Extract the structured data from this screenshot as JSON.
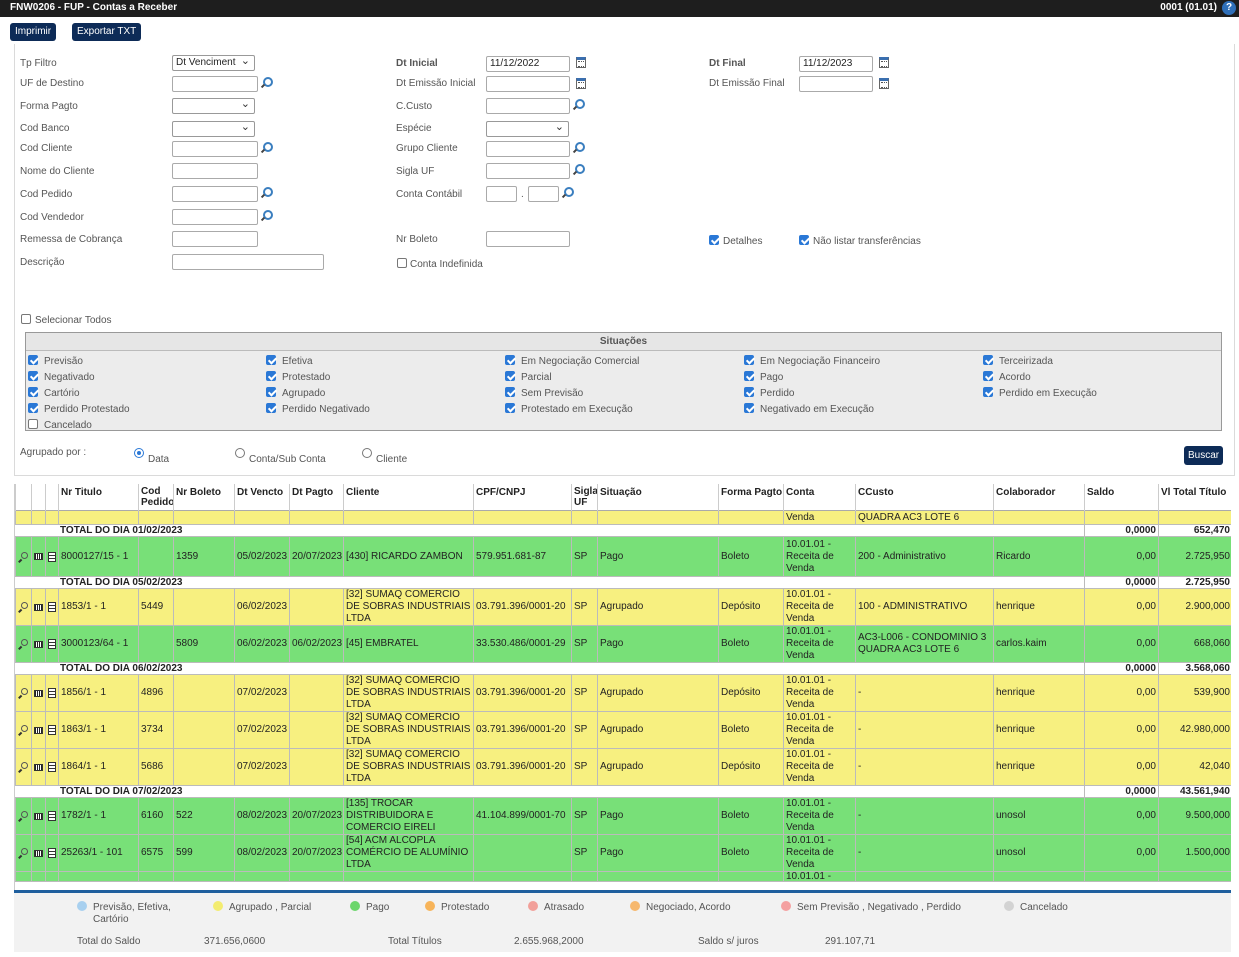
{
  "window": {
    "title": "FNW0206 - FUP - Contas a Receber",
    "right": "0001 (01.01)",
    "help": "?"
  },
  "toolbar": {
    "print": "Imprimir",
    "export": "Exportar TXT"
  },
  "filters": {
    "tp_filtro": {
      "label": "Tp Filtro",
      "value": "Dt Venciment"
    },
    "uf_destino": {
      "label": "UF de Destino"
    },
    "forma_pagto": {
      "label": "Forma Pagto"
    },
    "cod_banco": {
      "label": "Cod Banco"
    },
    "cod_cliente": {
      "label": "Cod Cliente"
    },
    "nome_cliente": {
      "label": "Nome do Cliente"
    },
    "cod_pedido": {
      "label": "Cod Pedido"
    },
    "cod_vendedor": {
      "label": "Cod Vendedor"
    },
    "remessa": {
      "label": "Remessa de Cobrança"
    },
    "descricao": {
      "label": "Descrição"
    },
    "dt_inicial": {
      "label": "Dt Inicial",
      "value": "11/12/2022"
    },
    "dt_emissao_inicial": {
      "label": "Dt Emissão Inicial"
    },
    "ccusto": {
      "label": "C.Custo"
    },
    "especie": {
      "label": "Espécie"
    },
    "grupo_cliente": {
      "label": "Grupo Cliente"
    },
    "sigla_uf": {
      "label": "Sigla UF"
    },
    "conta_contabil": {
      "label": "Conta Contábil",
      "sep": "."
    },
    "nr_boleto": {
      "label": "Nr Boleto"
    },
    "conta_indefinida": {
      "label": "Conta Indefinida"
    },
    "dt_final": {
      "label": "Dt Final",
      "value": "11/12/2023"
    },
    "dt_emissao_final": {
      "label": "Dt Emissão Final"
    },
    "detalhes": {
      "label": "Detalhes"
    },
    "nao_listar": {
      "label": "Não listar transferências"
    },
    "selecionar_todos": {
      "label": "Selecionar Todos"
    }
  },
  "situacoes": {
    "title": "Situações",
    "items": [
      [
        "Previsão",
        "Efetiva",
        "Em Negociação Comercial",
        "Em Negociação Financeiro",
        "Terceirizada"
      ],
      [
        "Negativado",
        "Protestado",
        "Parcial",
        "Pago",
        "Acordo"
      ],
      [
        "Cartório",
        "Agrupado",
        "Sem Previsão",
        "Perdido",
        "Perdido em Execução"
      ],
      [
        "Perdido Protestado",
        "Perdido Negativado",
        "Protestado em Execução",
        "Negativado em Execução",
        ""
      ],
      [
        "Cancelado",
        "",
        "",
        "",
        ""
      ]
    ]
  },
  "agrupado": {
    "label": "Agrupado por :",
    "options": [
      "Data",
      "Conta/Sub Conta",
      "Cliente"
    ],
    "selected": "Data"
  },
  "buscar": "Buscar",
  "columns": [
    "Nr Titulo",
    "Cod Pedido",
    "Nr Boleto",
    "Dt Vencto",
    "Dt Pagto",
    "Cliente",
    "CPF/CNPJ",
    "Sigla UF",
    "Situação",
    "Forma Pagto",
    "Conta",
    "CCusto",
    "Colaborador",
    "Saldo",
    "Vl Total Título"
  ],
  "rows": [
    {
      "type": "partial",
      "conta": "Venda",
      "ccusto": "QUADRA AC3 LOTE 6"
    },
    {
      "type": "total",
      "label": "TOTAL DO DIA 01/02/2023",
      "saldo": "0,0000",
      "total": "652,470"
    },
    {
      "type": "green",
      "nr": "8000127/15 - 1",
      "ped": "",
      "bol": "1359",
      "venc": "05/02/2023",
      "pag": "20/07/2023",
      "cli": "[430] RICARDO ZAMBON",
      "cpf": "579.951.681-87",
      "uf": "SP",
      "sit": "Pago",
      "forma": "Boleto",
      "conta": "10.01.01 - Receita de Venda",
      "cc": "200 - Administrativo",
      "col": "Ricardo",
      "saldo": "0,00",
      "total": "2.725,950"
    },
    {
      "type": "total",
      "label": "TOTAL DO DIA 05/02/2023",
      "saldo": "0,0000",
      "total": "2.725,950"
    },
    {
      "type": "yellow",
      "nr": "1853/1 - 1",
      "ped": "5449",
      "bol": "",
      "venc": "06/02/2023",
      "pag": "",
      "cli": "[32] SUMAQ COMERCIO DE SOBRAS INDUSTRIAIS LTDA",
      "cpf": "03.791.396/0001-20",
      "uf": "SP",
      "sit": "Agrupado",
      "forma": "Depósito",
      "conta": "10.01.01 - Receita de Venda",
      "cc": "100 - ADMINISTRATIVO",
      "col": "henrique",
      "saldo": "0,00",
      "total": "2.900,000"
    },
    {
      "type": "green",
      "nr": "3000123/64 - 1",
      "ped": "",
      "bol": "5809",
      "venc": "06/02/2023",
      "pag": "06/02/2023",
      "cli": "[45] EMBRATEL",
      "cpf": "33.530.486/0001-29",
      "uf": "SP",
      "sit": "Pago",
      "forma": "Boleto",
      "conta": "10.01.01 - Receita de Venda",
      "cc": "AC3-L006 - CONDOMINIO 3 QUADRA AC3 LOTE 6",
      "col": "carlos.kaim",
      "saldo": "0,00",
      "total": "668,060"
    },
    {
      "type": "total",
      "label": "TOTAL DO DIA 06/02/2023",
      "saldo": "0,0000",
      "total": "3.568,060"
    },
    {
      "type": "yellow",
      "nr": "1856/1 - 1",
      "ped": "4896",
      "bol": "",
      "venc": "07/02/2023",
      "pag": "",
      "cli": "[32] SUMAQ COMERCIO DE SOBRAS INDUSTRIAIS LTDA",
      "cpf": "03.791.396/0001-20",
      "uf": "SP",
      "sit": "Agrupado",
      "forma": "Depósito",
      "conta": "10.01.01 - Receita de Venda",
      "cc": "-",
      "col": "henrique",
      "saldo": "0,00",
      "total": "539,900"
    },
    {
      "type": "yellow",
      "nr": "1863/1 - 1",
      "ped": "3734",
      "bol": "",
      "venc": "07/02/2023",
      "pag": "",
      "cli": "[32] SUMAQ COMERCIO DE SOBRAS INDUSTRIAIS LTDA",
      "cpf": "03.791.396/0001-20",
      "uf": "SP",
      "sit": "Agrupado",
      "forma": "Boleto",
      "conta": "10.01.01 - Receita de Venda",
      "cc": "-",
      "col": "henrique",
      "saldo": "0,00",
      "total": "42.980,000"
    },
    {
      "type": "yellow",
      "nr": "1864/1 - 1",
      "ped": "5686",
      "bol": "",
      "venc": "07/02/2023",
      "pag": "",
      "cli": "[32] SUMAQ COMERCIO DE SOBRAS INDUSTRIAIS LTDA",
      "cpf": "03.791.396/0001-20",
      "uf": "SP",
      "sit": "Agrupado",
      "forma": "Depósito",
      "conta": "10.01.01 - Receita de Venda",
      "cc": "-",
      "col": "henrique",
      "saldo": "0,00",
      "total": "42,040"
    },
    {
      "type": "total",
      "label": "TOTAL DO DIA 07/02/2023",
      "saldo": "0,0000",
      "total": "43.561,940"
    },
    {
      "type": "green",
      "nr": "1782/1 - 1",
      "ped": "6160",
      "bol": "522",
      "venc": "08/02/2023",
      "pag": "20/07/2023",
      "cli": "[135] TROCAR DISTRIBUIDORA E COMERCIO EIRELI",
      "cpf": "41.104.899/0001-70",
      "uf": "SP",
      "sit": "Pago",
      "forma": "Boleto",
      "conta": "10.01.01 - Receita de Venda",
      "cc": "-",
      "col": "unosol",
      "saldo": "0,00",
      "total": "9.500,000"
    },
    {
      "type": "green",
      "nr": "25263/1 - 101",
      "ped": "6575",
      "bol": "599",
      "venc": "08/02/2023",
      "pag": "20/07/2023",
      "cli": "[54] ACM ALCOPLA COMÉRCIO DE ALUMÍNIO LTDA",
      "cpf": "",
      "uf": "SP",
      "sit": "Pago",
      "forma": "Boleto",
      "conta": "10.01.01 - Receita de Venda",
      "cc": "-",
      "col": "unosol",
      "saldo": "0,00",
      "total": "1.500,000"
    },
    {
      "type": "partialb",
      "conta": "10.01.01 -"
    }
  ],
  "legend": {
    "items": [
      {
        "label": "Previsão, Efetiva, Cartório",
        "color": "#a8d0ef"
      },
      {
        "label": "Agrupado , Parcial",
        "color": "#f3ec70"
      },
      {
        "label": "Pago",
        "color": "#6cd66c"
      },
      {
        "label": "Protestado",
        "color": "#f7b45a"
      },
      {
        "label": "Atrasado",
        "color": "#f2a09a"
      },
      {
        "label": "Negociado, Acordo",
        "color": "#f6b86e"
      },
      {
        "label": "Sem Previsão , Negativado , Perdido",
        "color": "#f4a0a0"
      },
      {
        "label": "Cancelado",
        "color": "#d3d3d3"
      }
    ],
    "total_saldo_label": "Total do Saldo",
    "total_saldo": "371.656,0600",
    "total_titulos_label": "Total Títulos",
    "total_titulos": "2.655.968,2000",
    "saldo_juros_label": "Saldo s/ juros",
    "saldo_juros": "291.107,71"
  }
}
